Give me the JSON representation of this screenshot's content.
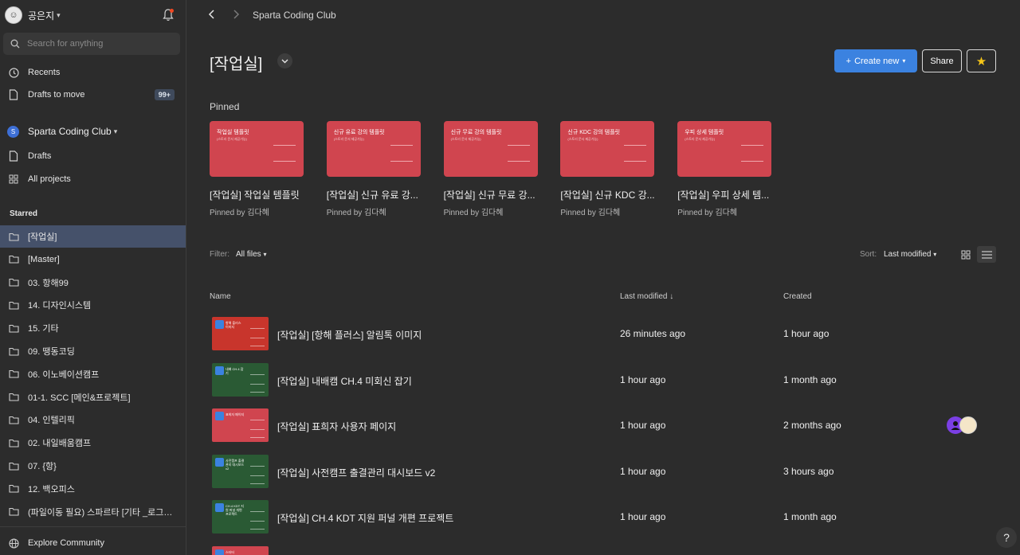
{
  "user": {
    "name": "공은지"
  },
  "search": {
    "placeholder": "Search for anything"
  },
  "nav": {
    "recents": "Recents",
    "drafts_to_move": "Drafts to move",
    "drafts_badge": "99+"
  },
  "team": {
    "initial": "S",
    "name": "Sparta Coding Club",
    "drafts": "Drafts",
    "all_projects": "All projects"
  },
  "starred": {
    "label": "Starred",
    "items": [
      "[작업실]",
      "[Master]",
      "03. 항해99",
      "14. 디자인시스템",
      "15. 기타",
      "09. 땡동코딩",
      "06. 이노베이션캠프",
      "01-1. SCC [메인&프로젝트]",
      "04. 인텔리픽",
      "02. 내일배움캠프",
      "07. {항}",
      "12. 백오피스",
      "(파일이동 필요) 스파르타 [기타 _로그인,마이..."
    ]
  },
  "footer": {
    "explore": "Explore Community"
  },
  "header": {
    "breadcrumb": "Sparta Coding Club",
    "title": "[작업실]"
  },
  "actions": {
    "create_new": "Create new",
    "share": "Share"
  },
  "pinned": {
    "label": "Pinned",
    "cards": [
      {
        "thumb_title": "작업실 템플릿",
        "thumb_sub": "(스토리 문서 제공가능)",
        "title": "[작업실] 작업실 템플릿",
        "by": "Pinned by 김다혜"
      },
      {
        "thumb_title": "신규 유료 강의 템플릿",
        "thumb_sub": "(스토리 문서 제공가능)",
        "title": "[작업실] 신규 유료 강...",
        "by": "Pinned by 김다혜"
      },
      {
        "thumb_title": "신규 무료 강의 템플릿",
        "thumb_sub": "(스토리 문서 제공가능)",
        "title": "[작업실] 신규 무료 강...",
        "by": "Pinned by 김다혜"
      },
      {
        "thumb_title": "신규 KDC 강의 템플릿",
        "thumb_sub": "(스토리 문서 제공가능)",
        "title": "[작업실] 신규 KDC 강...",
        "by": "Pinned by 김다혜"
      },
      {
        "thumb_title": "우피 상세 템플릿",
        "thumb_sub": "(스토리 문서 제공가능)",
        "title": "[작업실] 우피 상세 템...",
        "by": "Pinned by 김다혜"
      }
    ]
  },
  "filter": {
    "label": "Filter:",
    "value": "All files"
  },
  "sort": {
    "label": "Sort:",
    "value": "Last modified"
  },
  "columns": {
    "name": "Name",
    "modified": "Last modified ↓",
    "created": "Created"
  },
  "files": [
    {
      "name": "[작업실] [항해 플러스] 알림톡 이미지",
      "modified": "26 minutes ago",
      "created": "1 hour ago",
      "thumb_color": "#c8352c",
      "thumb_text": "항해 플러스 이미지"
    },
    {
      "name": "[작업실] 내배캠 CH.4 미회신 잡기",
      "modified": "1 hour ago",
      "created": "1 month ago",
      "thumb_color": "#2a5a34",
      "thumb_text": "내배 CH.4 잡기"
    },
    {
      "name": "[작업실] 표희자 사용자 페이지",
      "modified": "1 hour ago",
      "created": "2 months ago",
      "thumb_color": "#d0454f",
      "thumb_text": "표희자 페이지"
    },
    {
      "name": "[작업실] 사전캠프 출결관리 대시보드 v2",
      "modified": "1 hour ago",
      "created": "3 hours ago",
      "thumb_color": "#2a5a34",
      "thumb_text": "사전캠프 출결관리 대시보드 v2"
    },
    {
      "name": "[작업실] CH.4 KDT 지원 퍼널 개편 프로젝트",
      "modified": "1 hour ago",
      "created": "1 month ago",
      "thumb_color": "#2a5a34",
      "thumb_text": "CH.4 KDT 지원 퍼널 개편 프로젝트"
    },
    {
      "name": "",
      "modified": "",
      "created": "",
      "thumb_color": "#d0454f",
      "thumb_text": "스타터"
    }
  ],
  "help": "?"
}
